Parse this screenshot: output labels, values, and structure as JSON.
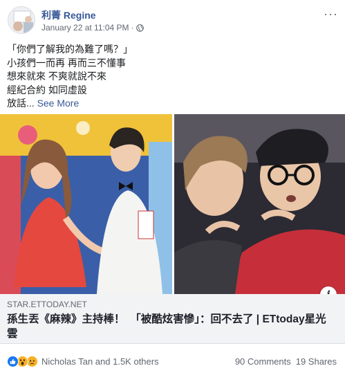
{
  "post": {
    "author": "利菁 Regine",
    "timestamp": "January 22 at 11:04 PM",
    "privacy_icon": "globe-icon",
    "more_icon": "ellipsis-icon",
    "more_label": "···",
    "text_lines": [
      "「你們了解我的為難了嗎？」",
      "小孩們一而再 再而三不懂事",
      "想來就來 不爽就說不來",
      "經紀合約 如同虛設"
    ],
    "truncated_line": "放話...",
    "see_more": "See More"
  },
  "link_preview": {
    "domain": "STAR.ETTODAY.NET",
    "headline": "孫生丟《麻辣》主持棒！　「被酷炫害慘」：回不去了 | ETtoday星光雲",
    "info_label": "i"
  },
  "footer": {
    "reaction_icons": [
      "like-icon",
      "wow-icon",
      "sad-icon"
    ],
    "reactors": "Nicholas Tan and 1.5K others",
    "comments": "90 Comments",
    "shares": "19 Shares"
  },
  "colors": {
    "link_blue": "#385898",
    "like_blue": "#1877f2",
    "reaction_yellow": "#f7b125",
    "muted": "#606770",
    "preview_bg": "#f2f3f5"
  }
}
